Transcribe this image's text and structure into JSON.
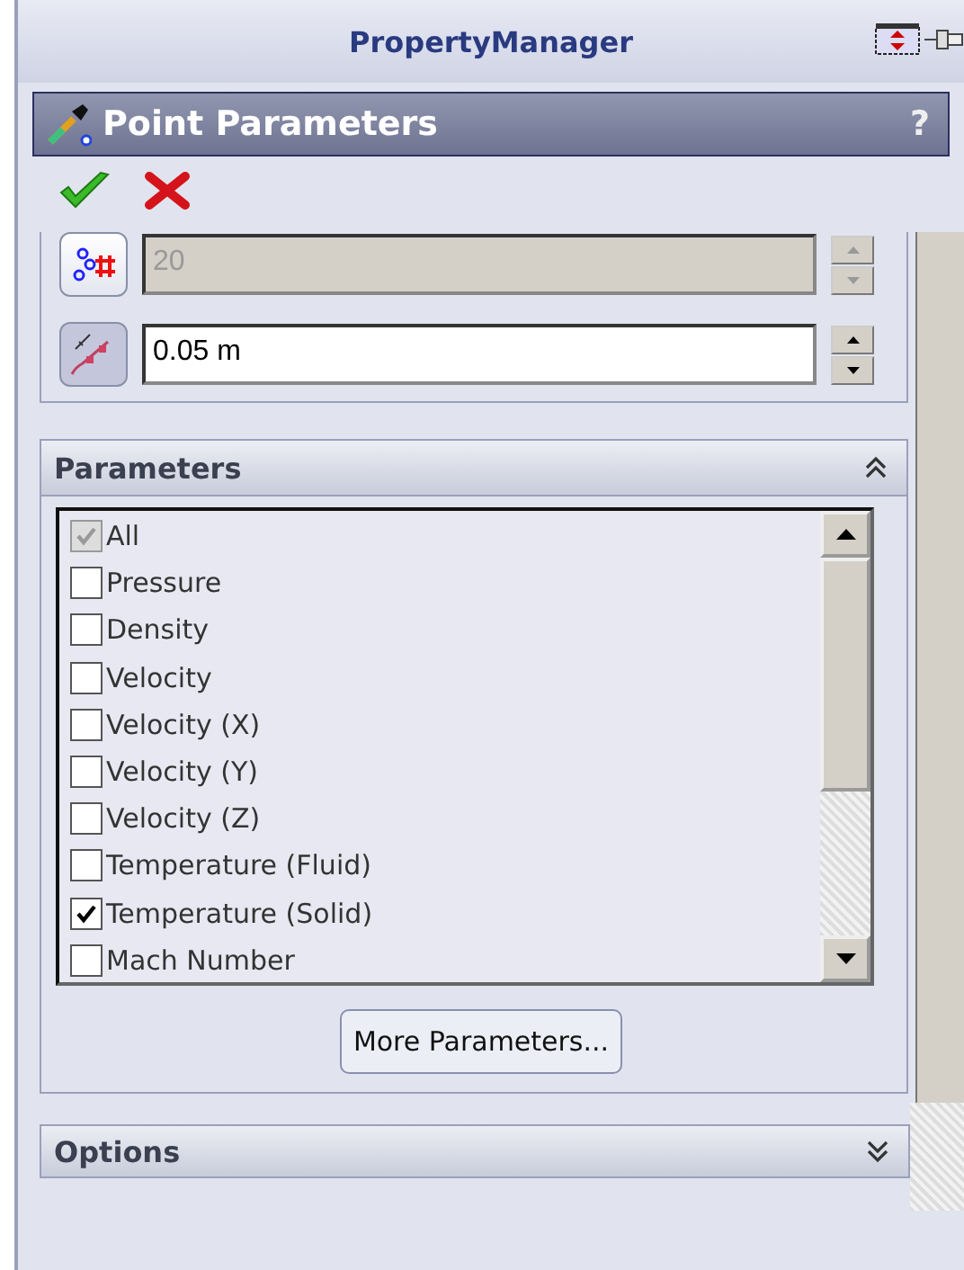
{
  "header": {
    "title": "PropertyManager"
  },
  "title_bar": {
    "title": "Point Parameters",
    "help": "?"
  },
  "fields": [
    {
      "kind": "count",
      "value": "20",
      "disabled": true
    },
    {
      "kind": "distance",
      "value": "0.05 m",
      "disabled": false
    }
  ],
  "parameters": {
    "title": "Parameters",
    "expanded": true,
    "items": [
      {
        "label": "All",
        "checked": true,
        "disabled": true
      },
      {
        "label": "Pressure",
        "checked": false,
        "disabled": false
      },
      {
        "label": "Density",
        "checked": false,
        "disabled": false
      },
      {
        "label": "Velocity",
        "checked": false,
        "disabled": false
      },
      {
        "label": "Velocity (X)",
        "checked": false,
        "disabled": false
      },
      {
        "label": "Velocity (Y)",
        "checked": false,
        "disabled": false
      },
      {
        "label": "Velocity (Z)",
        "checked": false,
        "disabled": false
      },
      {
        "label": "Temperature (Fluid)",
        "checked": false,
        "disabled": false
      },
      {
        "label": "Temperature (Solid)",
        "checked": true,
        "disabled": false
      },
      {
        "label": "Mach Number",
        "checked": false,
        "disabled": false
      }
    ],
    "button": "More Parameters..."
  },
  "options": {
    "title": "Options",
    "expanded": false
  }
}
